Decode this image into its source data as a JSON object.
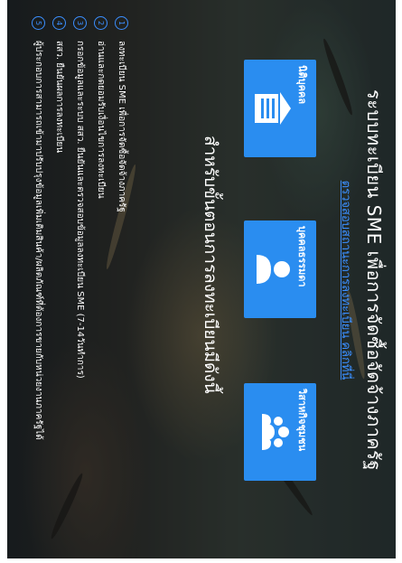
{
  "header": {
    "title": "ระบบทะเบียน SME เพื่อการจัดซื้อจัดจ้างภาครัฐ",
    "check_link": "ตรวจสอบสถานะการลงทะเบียน คลิกที่นี่"
  },
  "cards": [
    {
      "label": "นิติบุคคล",
      "icon": "building-icon"
    },
    {
      "label": "บุคคลธรรมดา",
      "icon": "person-icon"
    },
    {
      "label": "วิสาหกิจชุมชน",
      "icon": "community-icon"
    }
  ],
  "steps": {
    "title": "สำหรับขั้นตอนการลงทะเบียนมีดังนี้",
    "items": [
      {
        "num": "1",
        "text": "ลงทะเบียน SME เพื่อการจัดซื้อจัดจ้างภาครัฐ"
      },
      {
        "num": "2",
        "text": "อ่านและกดยอมรับเงื่อนไขการลงทะเบียน"
      },
      {
        "num": "3",
        "text": "กรอกข้อมูลและระบบ สสว. ยืนยันและตรวจสอบข้อมูลลงทะเบียน SME (7-14วันทำการ)"
      },
      {
        "num": "4",
        "text": "สสว. ยืนยันผลการลงทะเบียน"
      },
      {
        "num": "5",
        "text": "ผู้ประกอบการสามารถเข้ามาปรับปรุงข้อมูลเพิ่มเติมสินค้า/ผลิตภัณฑ์ที่ต้องการขายกับหน่วยงานภาครัฐได้"
      }
    ]
  },
  "colors": {
    "accent": "#2a8df0",
    "link": "#3b8fff"
  }
}
